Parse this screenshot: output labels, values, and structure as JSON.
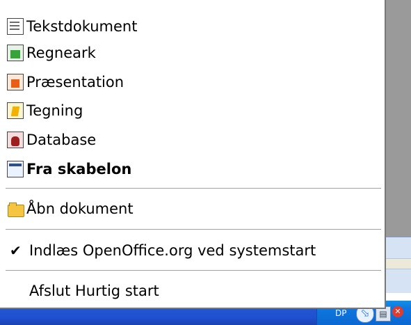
{
  "menu": {
    "items": [
      {
        "label": "Tekstdokument",
        "icon": "writer-document-icon"
      },
      {
        "label": "Regneark",
        "icon": "calc-spreadsheet-icon"
      },
      {
        "label": "Præsentation",
        "icon": "impress-presentation-icon"
      },
      {
        "label": "Tegning",
        "icon": "draw-drawing-icon"
      },
      {
        "label": "Database",
        "icon": "base-database-icon"
      },
      {
        "label": "Fra skabelon",
        "icon": "template-icon"
      },
      {
        "label": "Åbn dokument",
        "icon": "open-folder-icon"
      },
      {
        "label": "Indlæs OpenOffice.org ved systemstart",
        "checked": true
      },
      {
        "label": "Afslut Hurtig start"
      }
    ]
  },
  "taskbar": {
    "tray_label": "DP",
    "tray_icons": [
      "network-icon",
      "quickstart-icon",
      "security-alert-icon"
    ]
  },
  "colors": {
    "taskbar": "#2458d3",
    "tray": "#0e78e0",
    "menu_background": "#ffffff",
    "desktop": "#9a9a9a"
  }
}
